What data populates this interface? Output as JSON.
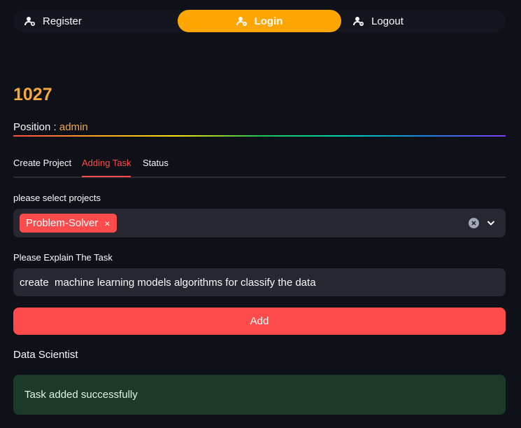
{
  "nav": {
    "items": [
      {
        "label": "Register",
        "icon": "user-add-icon"
      },
      {
        "label": "Login",
        "icon": "user-key-icon",
        "active": true
      },
      {
        "label": "Logout",
        "icon": "user-remove-icon"
      }
    ],
    "active_color": "#ffa500"
  },
  "user": {
    "id": "1027",
    "position_label": "Position :",
    "position_value": "admin"
  },
  "tabs": [
    {
      "label": "Create Project"
    },
    {
      "label": "Adding Task",
      "active": true
    },
    {
      "label": "Status"
    }
  ],
  "form": {
    "projects_label": "please select projects",
    "selected_projects": [
      "Problem-Solver"
    ],
    "chip_remove": "×",
    "task_label": "Please Explain The Task",
    "task_value": "create  machine learning models algorithms for classify the data",
    "add_label": "Add"
  },
  "role": "Data Scientist",
  "alert": {
    "message": "Task added successfully",
    "type": "success"
  },
  "colors": {
    "background": "#0e1117",
    "accent": "#ff4b4b",
    "highlight": "#f5a742",
    "success_bg": "#1b3a2a"
  }
}
